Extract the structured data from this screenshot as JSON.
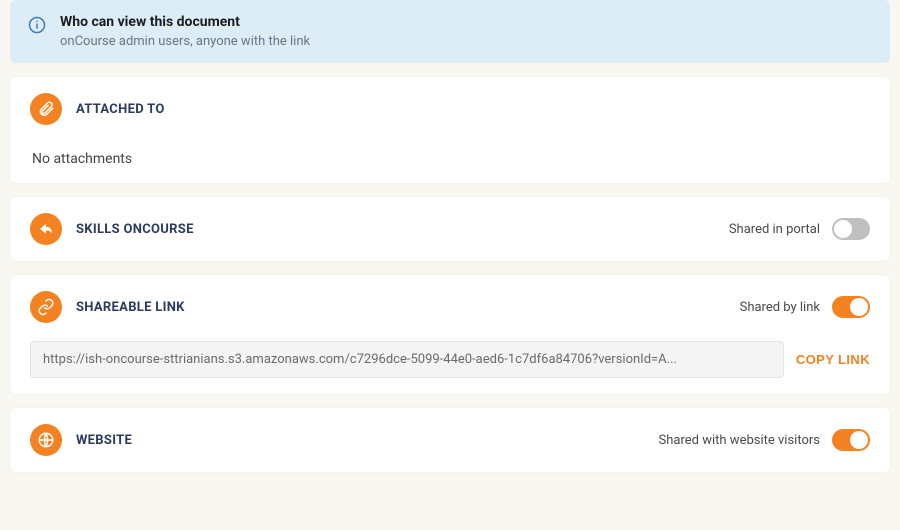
{
  "info": {
    "title": "Who can view this document",
    "subtitle": "onCourse admin users, anyone with the link"
  },
  "attached": {
    "title": "ATTACHED TO",
    "body": "No attachments"
  },
  "skills": {
    "title": "SKILLS ONCOURSE",
    "toggle_label": "Shared in portal",
    "toggle_on": false
  },
  "shareable": {
    "title": "SHAREABLE LINK",
    "toggle_label": "Shared by link",
    "toggle_on": true,
    "url": "https://ish-oncourse-sttrianians.s3.amazonaws.com/c7296dce-5099-44e0-aed6-1c7df6a84706?versionId=A...",
    "copy_label": "COPY LINK"
  },
  "website": {
    "title": "WEBSITE",
    "toggle_label": "Shared with website visitors",
    "toggle_on": true
  },
  "colors": {
    "accent": "#f58220",
    "info_bg": "#dcedf8",
    "heading": "#2a3b5f"
  }
}
